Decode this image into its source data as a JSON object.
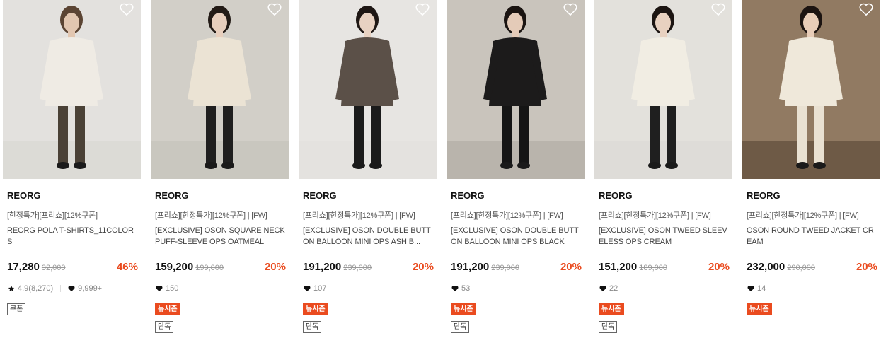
{
  "products": [
    {
      "brand": "REORG",
      "tags": "[한정특가][프리쇼][12%쿠폰]",
      "name": "REORG POLA T-SHIRTS_11COLORS",
      "price": "17,280",
      "original_price": "32,000",
      "discount": "46%",
      "rating": "4.9(8,270)",
      "likes": "9,999+",
      "badges": [
        "쿠폰"
      ],
      "badge_types": [
        "line"
      ],
      "photo": {
        "bg": "#dcdad6",
        "wall": "#e8e6e2",
        "top": "#efebe4",
        "bottom": "#4a4136",
        "hair": "#5b4433",
        "skin": "#e2c6b0"
      }
    },
    {
      "brand": "REORG",
      "tags": "[프리쇼][한정특가][12%쿠폰] | [FW]",
      "name": "[EXCLUSIVE] OSON SQUARE NECK PUFF-SLEEVE OPS OATMEAL",
      "price": "159,200",
      "original_price": "199,000",
      "discount": "20%",
      "likes": "150",
      "badges": [
        "뉴시즌",
        "단독"
      ],
      "badge_types": [
        "new",
        "line"
      ],
      "photo": {
        "bg": "#c9c6bf",
        "wall": "#d8d5ce",
        "top": "#ebe3d4",
        "bottom": "#1f1f1f",
        "hair": "#231b16",
        "skin": "#e8cfbd"
      }
    },
    {
      "brand": "REORG",
      "tags": "[프리쇼][한정특가][12%쿠폰] | [FW]",
      "name": "[EXCLUSIVE] OSON DOUBLE BUTTON BALLOON MINI OPS ASH B...",
      "price": "191,200",
      "original_price": "239,000",
      "discount": "20%",
      "likes": "107",
      "badges": [
        "뉴시즌",
        "단독"
      ],
      "badge_types": [
        "new",
        "line"
      ],
      "photo": {
        "bg": "#e3e2df",
        "wall": "#e9e8e5",
        "top": "#5b5048",
        "bottom": "#1b1b1b",
        "hair": "#1e1714",
        "skin": "#e8d2c2"
      }
    },
    {
      "brand": "REORG",
      "tags": "[프리쇼][한정특가][12%쿠폰] | [FW]",
      "name": "[EXCLUSIVE] OSON DOUBLE BUTTON BALLOON MINI OPS BLACK",
      "price": "191,200",
      "original_price": "239,000",
      "discount": "20%",
      "likes": "53",
      "badges": [
        "뉴시즌",
        "단독"
      ],
      "badge_types": [
        "new",
        "line"
      ],
      "photo": {
        "bg": "#b9b4ac",
        "wall": "#d4cfc6",
        "top": "#1c1b1b",
        "bottom": "#151515",
        "hair": "#1a1411",
        "skin": "#e4cbb8"
      }
    },
    {
      "brand": "REORG",
      "tags": "[프리쇼][한정특가][12%쿠폰] | [FW]",
      "name": "[EXCLUSIVE] OSON TWEED SLEEVELESS OPS CREAM",
      "price": "151,200",
      "original_price": "189,000",
      "discount": "20%",
      "likes": "22",
      "badges": [
        "뉴시즌",
        "단독"
      ],
      "badge_types": [
        "new",
        "line"
      ],
      "photo": {
        "bg": "#dedcd8",
        "wall": "#e6e4e0",
        "top": "#f1ede3",
        "bottom": "#1f1f1f",
        "hair": "#1c1512",
        "skin": "#e8d1c0"
      }
    },
    {
      "brand": "REORG",
      "tags": "[프리쇼][한정특가][12%쿠폰] | [FW]",
      "name": "OSON ROUND TWEED JACKET CREAM",
      "price": "232,000",
      "original_price": "290,000",
      "discount": "20%",
      "likes": "14",
      "badges": [
        "뉴시즌"
      ],
      "badge_types": [
        "new"
      ],
      "photo": {
        "bg": "#6e5a46",
        "wall": "#a88f74",
        "top": "#efe8da",
        "bottom": "#e9e1d2",
        "hair": "#1c1411",
        "skin": "#e8cdb8"
      }
    }
  ]
}
